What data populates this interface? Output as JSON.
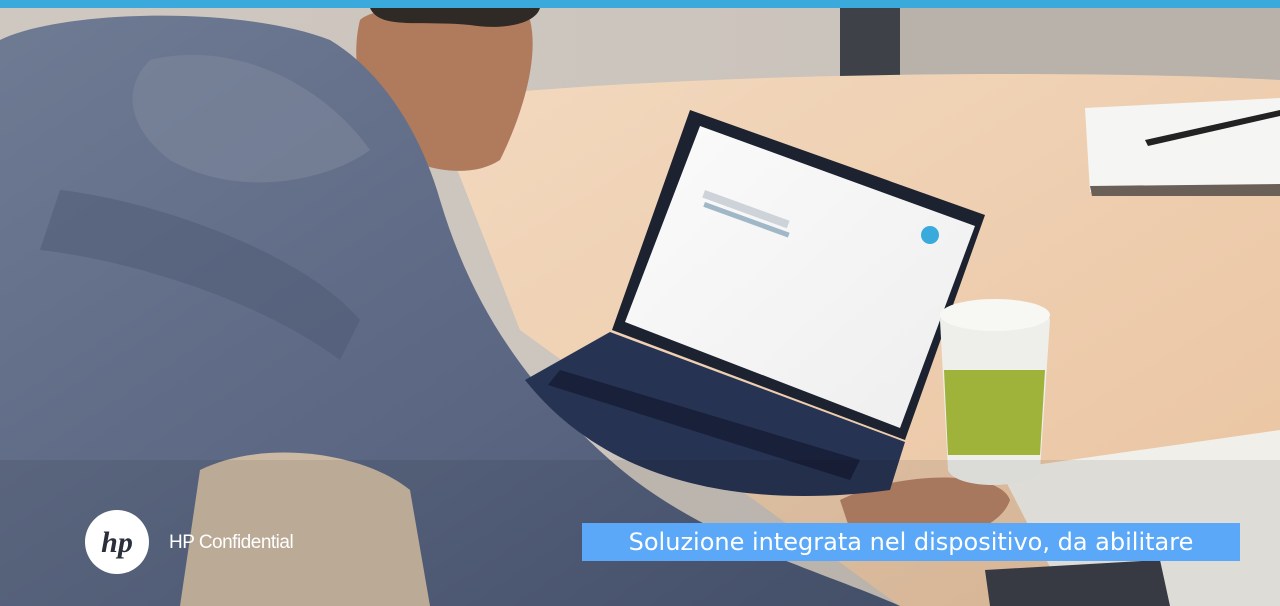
{
  "accent_color": "#3aa9dc",
  "banner_color": "#5aa8f7",
  "footer": {
    "confidential_label": "HP Confidential"
  },
  "banner": {
    "text": "Soluzione integrata nel dispositivo, da abilitare"
  },
  "logo": {
    "text": "hp"
  },
  "photo": {
    "icons": [
      "person-photo",
      "laptop-icon",
      "coffee-cup-icon",
      "notebook-icon",
      "pen-icon"
    ]
  }
}
